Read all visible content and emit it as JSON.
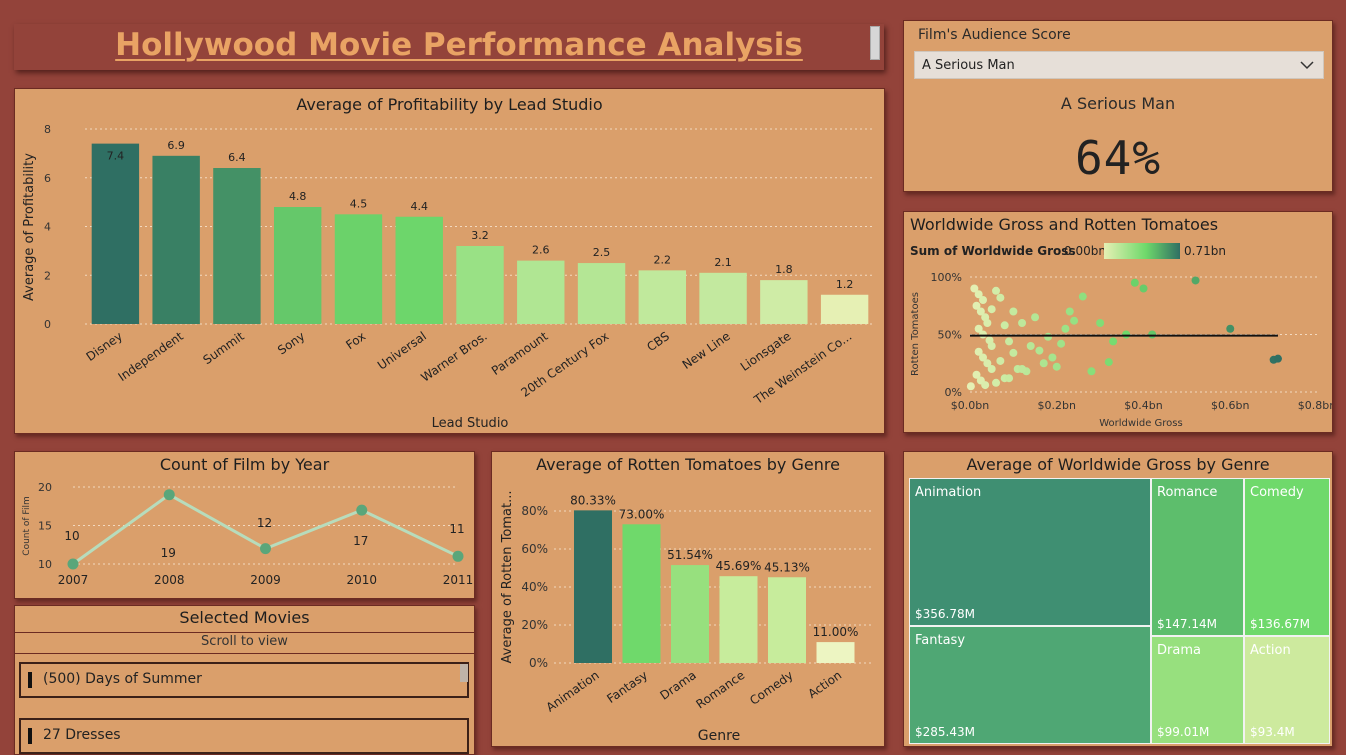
{
  "header": {
    "title": "Hollywood Movie Performance Analysis"
  },
  "colors": {
    "background": "#93433a",
    "panel": "#da9f6b",
    "title": "#e9a364",
    "dark_teal": "#2f6f63",
    "green": "#6fd96b",
    "pale": "#e6f0b4"
  },
  "audience_card": {
    "label": "Film's Audience Score",
    "selected_film": "A Serious Man",
    "film_name": "A Serious Man",
    "score": "64%"
  },
  "profitability_chart": {
    "title": "Average of Profitability by Lead Studio",
    "chart_data": {
      "type": "bar",
      "title": "Average of Profitability by Lead Studio",
      "xlabel": "Lead Studio",
      "ylabel": "Average of Profitability",
      "categories": [
        "Disney",
        "Independent",
        "Summit",
        "Sony",
        "Fox",
        "Universal",
        "Warner Bros.",
        "Paramount",
        "20th Century Fox",
        "CBS",
        "New Line",
        "Lionsgate",
        "The Weinstein Co..."
      ],
      "values": [
        7.4,
        6.9,
        6.4,
        4.8,
        4.5,
        4.4,
        3.2,
        2.6,
        2.5,
        2.2,
        2.1,
        1.8,
        1.2
      ],
      "labels": [
        "7.4",
        "6.9",
        "6.4",
        "4.8",
        "4.5",
        "4.4",
        "3.2",
        "2.6",
        "2.5",
        "2.2",
        "2.1",
        "1.8",
        "1.2"
      ],
      "ylim": [
        0,
        8
      ],
      "yticks": [
        "0",
        "2",
        "4",
        "6",
        "8"
      ],
      "grid": true
    }
  },
  "scatter_chart": {
    "title": "Worldwide Gross and Rotten Tomatoes",
    "legend_title": "Sum of Worldwide Gross",
    "legend_min": "0.00bn",
    "legend_max": "0.71bn",
    "chart_data": {
      "type": "scatter",
      "xlabel": "Worldwide Gross",
      "ylabel": "Rotten Tomatoes",
      "xlim": [
        0,
        0.8
      ],
      "ylim": [
        0,
        100
      ],
      "xticks": [
        "$0.0bn",
        "$0.2bn",
        "$0.4bn",
        "$0.6bn",
        "$0.8bn"
      ],
      "yticks": [
        "0%",
        "50%",
        "100%"
      ],
      "trend_line": {
        "x": [
          0,
          0.71
        ],
        "y": [
          49,
          49
        ]
      },
      "points": [
        [
          0.01,
          90
        ],
        [
          0.02,
          85
        ],
        [
          0.03,
          80
        ],
        [
          0.015,
          75
        ],
        [
          0.025,
          70
        ],
        [
          0.035,
          65
        ],
        [
          0.04,
          60
        ],
        [
          0.02,
          55
        ],
        [
          0.03,
          50
        ],
        [
          0.045,
          45
        ],
        [
          0.05,
          40
        ],
        [
          0.02,
          35
        ],
        [
          0.03,
          30
        ],
        [
          0.04,
          25
        ],
        [
          0.05,
          20
        ],
        [
          0.015,
          15
        ],
        [
          0.025,
          10
        ],
        [
          0.035,
          6
        ],
        [
          0.002,
          5
        ],
        [
          0.06,
          88
        ],
        [
          0.07,
          82
        ],
        [
          0.05,
          72
        ],
        [
          0.08,
          58
        ],
        [
          0.09,
          44
        ],
        [
          0.1,
          34
        ],
        [
          0.07,
          27
        ],
        [
          0.11,
          20
        ],
        [
          0.13,
          18
        ],
        [
          0.08,
          12
        ],
        [
          0.06,
          8
        ],
        [
          0.12,
          60
        ],
        [
          0.15,
          65
        ],
        [
          0.14,
          40
        ],
        [
          0.16,
          36
        ],
        [
          0.18,
          48
        ],
        [
          0.19,
          30
        ],
        [
          0.2,
          22
        ],
        [
          0.21,
          42
        ],
        [
          0.23,
          70
        ],
        [
          0.24,
          62
        ],
        [
          0.26,
          83
        ],
        [
          0.3,
          60
        ],
        [
          0.32,
          26
        ],
        [
          0.33,
          44
        ],
        [
          0.36,
          50
        ],
        [
          0.38,
          95
        ],
        [
          0.4,
          90
        ],
        [
          0.42,
          50
        ],
        [
          0.52,
          97
        ],
        [
          0.6,
          55
        ],
        [
          0.7,
          28
        ],
        [
          0.71,
          29
        ],
        [
          0.22,
          55
        ],
        [
          0.17,
          25
        ],
        [
          0.28,
          18
        ],
        [
          0.1,
          70
        ],
        [
          0.12,
          20
        ],
        [
          0.09,
          12
        ]
      ]
    }
  },
  "year_chart": {
    "title": "Count of Film by Year",
    "chart_data": {
      "type": "line",
      "ylabel": "Count of Film",
      "x": [
        "2007",
        "2008",
        "2009",
        "2010",
        "2011"
      ],
      "values": [
        10,
        19,
        12,
        17,
        11
      ],
      "labels": [
        "10",
        "19",
        "12",
        "17",
        "11"
      ],
      "ylim": [
        10,
        20
      ],
      "yticks": [
        "10",
        "15",
        "20"
      ]
    }
  },
  "genre_rt_chart": {
    "title": "Average of Rotten Tomatoes by Genre",
    "chart_data": {
      "type": "bar",
      "xlabel": "Genre",
      "ylabel": "Average of Rotten Tomat...",
      "categories": [
        "Animation",
        "Fantasy",
        "Drama",
        "Romance",
        "Comedy",
        "Action"
      ],
      "values": [
        80.33,
        73.0,
        51.54,
        45.69,
        45.13,
        11.0
      ],
      "labels": [
        "80.33%",
        "73.00%",
        "51.54%",
        "45.69%",
        "45.13%",
        "11.00%"
      ],
      "ylim": [
        0,
        90
      ],
      "yticks": [
        "0%",
        "20%",
        "40%",
        "60%",
        "80%"
      ]
    }
  },
  "treemap": {
    "title": "Average of Worldwide Gross by Genre",
    "chart_data": {
      "type": "treemap",
      "categories": [
        "Animation",
        "Fantasy",
        "Romance",
        "Comedy",
        "Drama",
        "Action"
      ],
      "values": [
        356.78,
        285.43,
        147.14,
        136.67,
        99.01,
        93.4
      ],
      "labels": [
        "$356.78M",
        "$285.43M",
        "$147.14M",
        "$136.67M",
        "$99.01M",
        "$93.4M"
      ]
    }
  },
  "selected_movies": {
    "title": "Selected Movies",
    "subtitle": "Scroll to view",
    "items": [
      "(500) Days of Summer",
      "27 Dresses"
    ]
  }
}
